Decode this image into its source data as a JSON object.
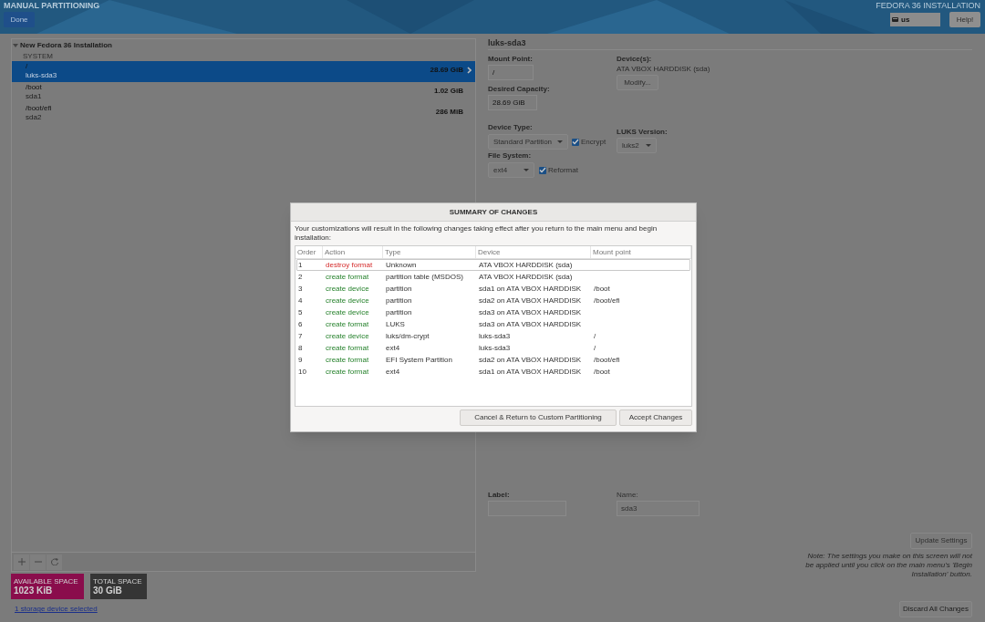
{
  "header": {
    "title": "MANUAL PARTITIONING",
    "done_button": "Done",
    "product": "FEDORA 36 INSTALLATION",
    "keyboard_layout": "us",
    "help_button": "Help!"
  },
  "left": {
    "installation": {
      "title": "New Fedora 36 Installation",
      "expanded": true
    },
    "section": "SYSTEM",
    "mounts": [
      {
        "mount": "/",
        "device": "luks-sda3",
        "size": "28.69 GiB",
        "selected": true
      },
      {
        "mount": "/boot",
        "device": "sda1",
        "size": "1.02 GiB",
        "selected": false
      },
      {
        "mount": "/boot/efi",
        "device": "sda2",
        "size": "286 MiB",
        "selected": false
      }
    ],
    "available_space": {
      "label": "AVAILABLE SPACE",
      "value": "1023 KiB"
    },
    "total_space": {
      "label": "TOTAL SPACE",
      "value": "30 GiB"
    },
    "storage_link": "1 storage device selected"
  },
  "right": {
    "title": "luks-sda3",
    "mount_point": {
      "label": "Mount Point:",
      "value": "/"
    },
    "desired_capacity": {
      "label": "Desired Capacity:",
      "value": "28.69 GiB"
    },
    "devices": {
      "label": "Device(s):",
      "value": "ATA VBOX HARDDISK (sda)",
      "button": "Modify..."
    },
    "device_type": {
      "label": "Device Type:",
      "value": "Standard Partition"
    },
    "encrypt": {
      "label": "Encrypt",
      "checked": true
    },
    "luks_version": {
      "label": "LUKS Version:",
      "value": "luks2"
    },
    "file_system": {
      "label": "File System:",
      "value": "ext4"
    },
    "reformat": {
      "label": "Reformat",
      "checked": true
    },
    "label_field": {
      "label": "Label:"
    },
    "name_field": {
      "label": "Name:",
      "value": "sda3"
    },
    "update_button": "Update Settings",
    "note": "Note:  The settings you make on this screen will not be applied until you click on the main menu's 'Begin Installation' button.",
    "discard_button": "Discard All Changes"
  },
  "dialog": {
    "title": "SUMMARY OF CHANGES",
    "message": "Your customizations will result in the following changes taking effect after you return to the main menu and begin installation:",
    "columns": [
      "Order",
      "Action",
      "Type",
      "Device",
      "Mount point"
    ],
    "rows": [
      {
        "order": "1",
        "action": "destroy format",
        "kind": "destroy",
        "type": "Unknown",
        "device": "ATA VBOX HARDDISK (sda)",
        "mount_point": "",
        "selected": true
      },
      {
        "order": "2",
        "action": "create format",
        "kind": "create",
        "type": "partition table (MSDOS)",
        "device": "ATA VBOX HARDDISK (sda)",
        "mount_point": "",
        "selected": false
      },
      {
        "order": "3",
        "action": "create device",
        "kind": "create",
        "type": "partition",
        "device": "sda1 on ATA VBOX HARDDISK",
        "mount_point": "/boot",
        "selected": false
      },
      {
        "order": "4",
        "action": "create device",
        "kind": "create",
        "type": "partition",
        "device": "sda2 on ATA VBOX HARDDISK",
        "mount_point": "/boot/efi",
        "selected": false
      },
      {
        "order": "5",
        "action": "create device",
        "kind": "create",
        "type": "partition",
        "device": "sda3 on ATA VBOX HARDDISK",
        "mount_point": "",
        "selected": false
      },
      {
        "order": "6",
        "action": "create format",
        "kind": "create",
        "type": "LUKS",
        "device": "sda3 on ATA VBOX HARDDISK",
        "mount_point": "",
        "selected": false
      },
      {
        "order": "7",
        "action": "create device",
        "kind": "create",
        "type": "luks/dm-crypt",
        "device": "luks-sda3",
        "mount_point": "/",
        "selected": false
      },
      {
        "order": "8",
        "action": "create format",
        "kind": "create",
        "type": "ext4",
        "device": "luks-sda3",
        "mount_point": "/",
        "selected": false
      },
      {
        "order": "9",
        "action": "create format",
        "kind": "create",
        "type": "EFI System Partition",
        "device": "sda2 on ATA VBOX HARDDISK",
        "mount_point": "/boot/efi",
        "selected": false
      },
      {
        "order": "10",
        "action": "create format",
        "kind": "create",
        "type": "ext4",
        "device": "sda1 on ATA VBOX HARDDISK",
        "mount_point": "/boot",
        "selected": false
      }
    ],
    "buttons": [
      "Cancel & Return to Custom Partitioning",
      "Accept Changes"
    ]
  }
}
